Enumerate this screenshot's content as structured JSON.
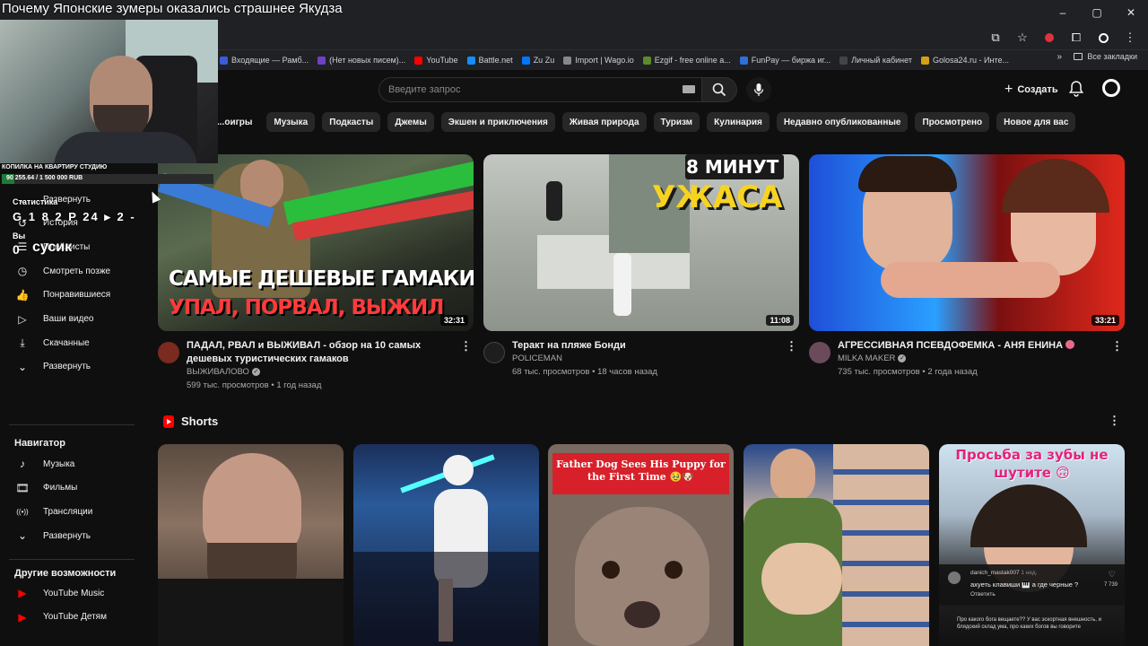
{
  "stream": {
    "title": "Почему Японские зумеры оказались страшнее Якудза"
  },
  "browser": {
    "win_controls": [
      "–",
      "▢",
      "✕"
    ],
    "bookmarks": [
      {
        "label": "Входящие — Рамб...",
        "color": "#3b5bdb"
      },
      {
        "label": "(Нет новых писем)...",
        "color": "#6f42c1"
      },
      {
        "label": "YouTube",
        "color": "#ff0000"
      },
      {
        "label": "Battle.net",
        "color": "#148eff"
      },
      {
        "label": "Zu Zu",
        "color": "#0077ff"
      },
      {
        "label": "Import | Wago.io",
        "color": "#888888"
      },
      {
        "label": "Ezgif - free online a...",
        "color": "#5c8a2e"
      },
      {
        "label": "FunPay — биржа иг...",
        "color": "#2f6fdb"
      },
      {
        "label": "Личный кабинет",
        "color": "#444444"
      },
      {
        "label": "Golosa24.ru - Инте...",
        "color": "#d4a017"
      }
    ],
    "more_bookmarks": "»",
    "all_bookmarks": "Все закладки"
  },
  "header": {
    "search_placeholder": "Введите запрос",
    "create_label": "Создать"
  },
  "chips": [
    "...оигры",
    "Музыка",
    "Подкасты",
    "Джемы",
    "Экшен и приключения",
    "Живая природа",
    "Туризм",
    "Кулинария",
    "Недавно опубликованные",
    "Просмотрено",
    "Новое для вас"
  ],
  "overlay": {
    "donation_title": "КОПИЛКА НА КВАРТИРУ СТУДИЮ",
    "donation_text": "90 255.64 / 1 500 000 RUB",
    "donation_progress": 0.06,
    "stats_title": "Статистика",
    "stats_numbers": "G 1 8 2 P 24 ▸ 2 -",
    "stats_prefix": "Вы",
    "stats_zero": "0",
    "stats_user": "сусик"
  },
  "sidebar": {
    "items_top": [
      {
        "label": "Развернуть",
        "icon": "chevron-down-icon",
        "glyph": "⌄"
      },
      {
        "label": "История",
        "icon": "history-icon",
        "glyph": "↺"
      },
      {
        "label": "Плейлисты",
        "icon": "playlist-icon",
        "glyph": "☰"
      },
      {
        "label": "Смотреть позже",
        "icon": "clock-icon",
        "glyph": "◷"
      },
      {
        "label": "Понравившиеся",
        "icon": "like-icon",
        "glyph": "👍"
      },
      {
        "label": "Ваши видео",
        "icon": "video-icon",
        "glyph": "▷"
      },
      {
        "label": "Скачанные",
        "icon": "download-icon",
        "glyph": "⤓"
      },
      {
        "label": "Развернуть",
        "icon": "chevron-down-icon",
        "glyph": "⌄"
      }
    ],
    "navigator_title": "Навигатор",
    "navigator": [
      {
        "label": "Музыка",
        "icon": "music-icon",
        "glyph": "♪"
      },
      {
        "label": "Фильмы",
        "icon": "film-icon",
        "glyph": "🎞"
      },
      {
        "label": "Трансляции",
        "icon": "live-icon",
        "glyph": "((•))"
      },
      {
        "label": "Развернуть",
        "icon": "chevron-down-icon",
        "glyph": "⌄"
      }
    ],
    "more_title": "Другие возможности",
    "more": [
      {
        "label": "YouTube Music",
        "icon": "youtube-music-icon",
        "glyph": "▶"
      },
      {
        "label": "YouTube Детям",
        "icon": "youtube-kids-icon",
        "glyph": "▶"
      }
    ]
  },
  "videos": [
    {
      "title": "ПАДАЛ, РВАЛ и ВЫЖИВАЛ - обзор на 10 самых дешевых туристических гамаков",
      "channel": "ВЫЖИВАЛОВО",
      "verified": true,
      "views": "599 тыс. просмотров",
      "age": "1 год назад",
      "duration": "32:31",
      "thumb_line1": "САМЫЕ ДЕШЕВЫЕ ГАМАКИ",
      "thumb_line2": "УПАЛ, ПОРВАЛ, ВЫЖИЛ",
      "avatar_color": "#7a2a1f"
    },
    {
      "title": "Теракт на пляже Бонди",
      "channel": "POLICEMAN",
      "verified": false,
      "views": "68 тыс. просмотров",
      "age": "18 часов назад",
      "duration": "11:08",
      "thumb_line1": "8 МИНУТ",
      "thumb_line2": "УЖАСА",
      "avatar_color": "#1e1e1e"
    },
    {
      "title": "АГРЕССИВНАЯ ПСЕВДОФЕМКА - АНЯ ЕНИНА",
      "channel": "MILKA MAKER",
      "verified": true,
      "views": "735 тыс. просмотров",
      "age": "2 года назад",
      "duration": "33:21",
      "avatar_color": "#6b4a5c"
    }
  ],
  "shorts": {
    "label": "Shorts",
    "items": [
      {
        "banner": ""
      },
      {
        "banner": ""
      },
      {
        "banner": "Father Dog Sees His Puppy for the First Time 🥹🐶"
      },
      {
        "banner": ""
      },
      {
        "banner": "Просьба за зубы не шутите 🙃",
        "comment_user": "danich_mastak007",
        "comment_age": "1 нед.",
        "comment_text": "ахуеть клавиши 🎹 а где черные ?",
        "comment_reply": "Ответить",
        "comment_likes": "7 739",
        "caption": "Про какого бога вещаете?? У вас эскортная внешность, и блядский склад ума, про каких богов вы говорите"
      }
    ]
  }
}
